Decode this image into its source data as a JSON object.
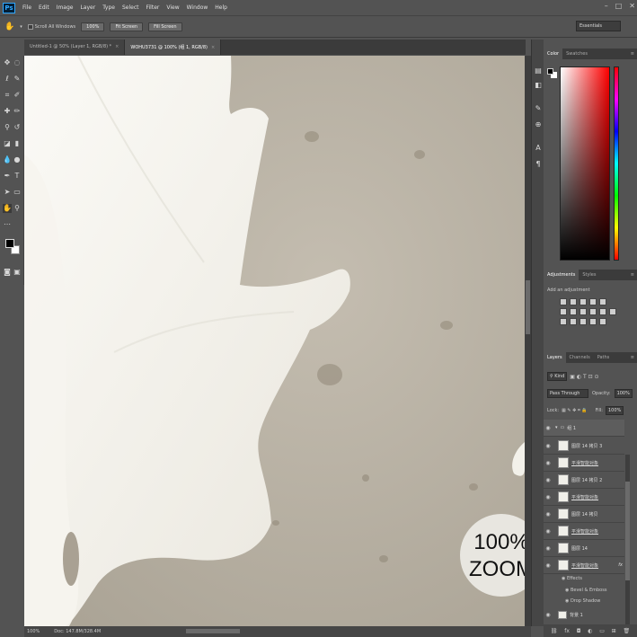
{
  "menubar": {
    "logo": "Ps",
    "items": [
      "File",
      "Edit",
      "Image",
      "Layer",
      "Type",
      "Select",
      "Filter",
      "View",
      "Window",
      "Help"
    ]
  },
  "options_bar": {
    "scroll_all_windows": "Scroll All Windows",
    "zoom_100": "100%",
    "fit_screen": "Fit Screen",
    "fill_screen": "Fill Screen",
    "workspace": "Essentials"
  },
  "doc_tabs": [
    {
      "title": "Untitled-1 @ 50% (Layer 1, RGB/8) *",
      "active": false
    },
    {
      "title": "WOHU3731 @ 100% (组 1, RGB/8)",
      "active": true
    }
  ],
  "canvas": {
    "zoom_badge_line1": "100%",
    "zoom_badge_line2": "ZOOM"
  },
  "statusbar": {
    "zoom": "100%",
    "doc": "Doc: 147.8M/328.4M"
  },
  "color_panel": {
    "tabs": [
      "Color",
      "Swatches"
    ]
  },
  "adjustments_panel": {
    "tabs": [
      "Adjustments",
      "Styles"
    ],
    "hint": "Add an adjustment"
  },
  "layers_panel": {
    "tabs": [
      "Layers",
      "Channels",
      "Paths"
    ],
    "filter": "Kind",
    "blend_mode": "Pass Through",
    "opacity_label": "Opacity:",
    "opacity_value": "100%",
    "lock_label": "Lock:",
    "fill_label": "Fill:",
    "fill_value": "100%",
    "layers": [
      {
        "name": "组 1",
        "type": "folder"
      },
      {
        "name": "图层 14 拷贝 3",
        "type": "layer"
      },
      {
        "name": "平滑智能对象",
        "type": "smart"
      },
      {
        "name": "图层 14 拷贝 2",
        "type": "layer"
      },
      {
        "name": "平滑智能对象",
        "type": "smart"
      },
      {
        "name": "图层 14 拷贝",
        "type": "layer"
      },
      {
        "name": "平滑智能对象",
        "type": "smart"
      },
      {
        "name": "图层 14",
        "type": "layer"
      },
      {
        "name": "平滑智能对象",
        "type": "smart",
        "fx": "fx"
      }
    ],
    "effects": [
      "Effects",
      "Bevel & Emboss",
      "Drop Shadow"
    ],
    "bottom_layer": "背景 1"
  }
}
